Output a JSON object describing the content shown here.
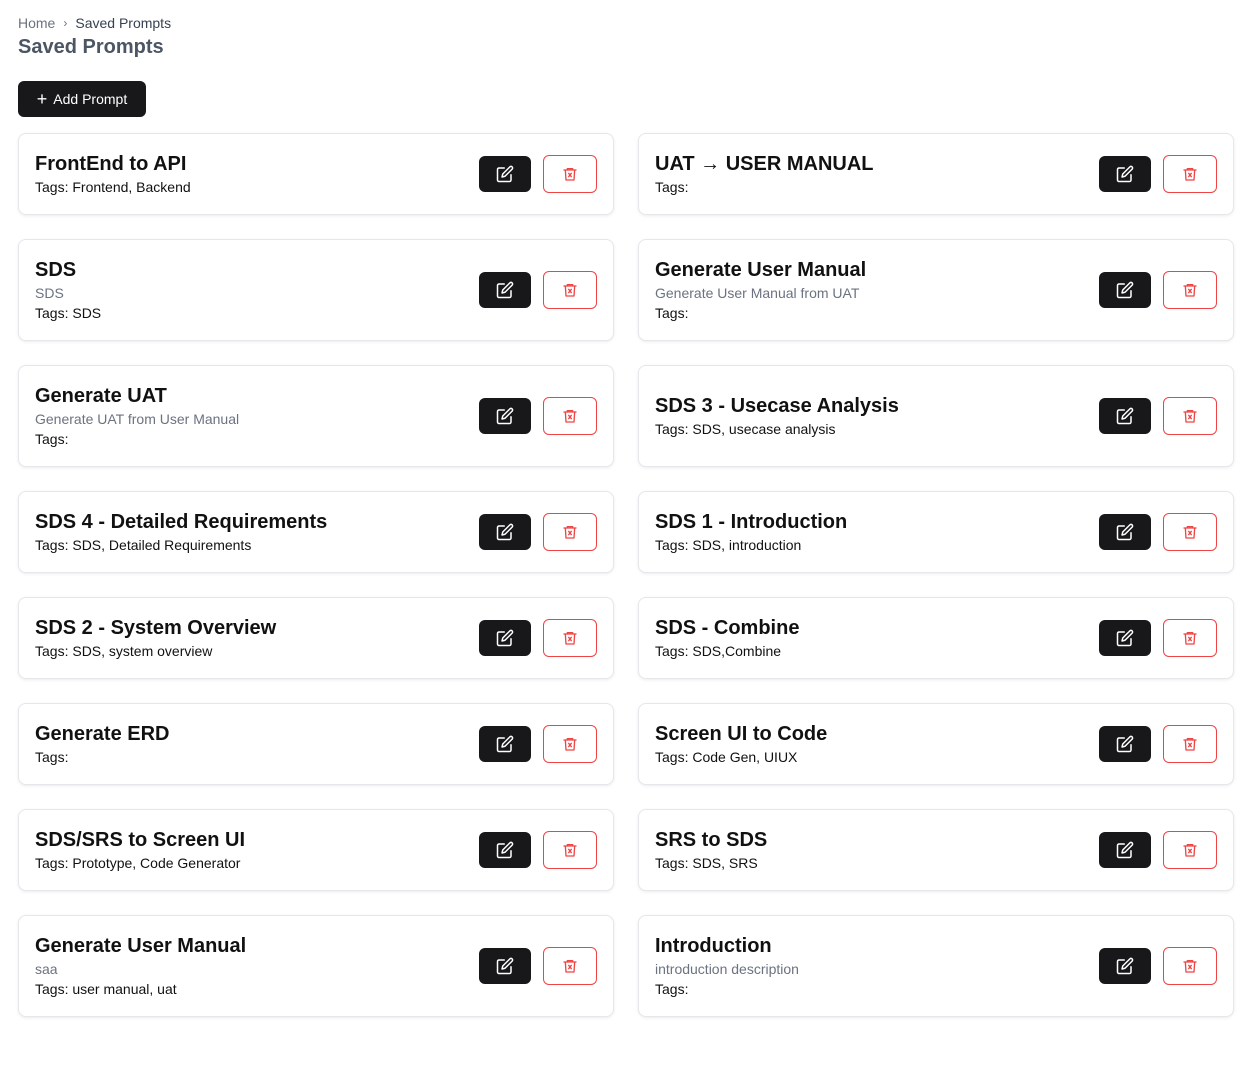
{
  "breadcrumb": {
    "home": "Home",
    "separator": "›",
    "current": "Saved Prompts"
  },
  "page_title": "Saved Prompts",
  "add_button": {
    "icon": "plus-icon",
    "label": "Add Prompt"
  },
  "colors": {
    "primary": "#18181b",
    "danger": "#ef4444",
    "muted": "#6b7280"
  },
  "prompts_left": [
    {
      "title": "FrontEnd to API",
      "description": "",
      "tags": "Tags: Frontend, Backend"
    },
    {
      "title": "SDS",
      "description": "SDS",
      "tags": "Tags: SDS"
    },
    {
      "title": "Generate UAT",
      "description": "Generate UAT from User Manual",
      "tags": "Tags:"
    },
    {
      "title": "SDS 4 - Detailed Requirements",
      "description": "",
      "tags": "Tags: SDS, Detailed Requirements"
    },
    {
      "title": "SDS 2 - System Overview",
      "description": "",
      "tags": "Tags: SDS, system overview"
    },
    {
      "title": "Generate ERD",
      "description": "",
      "tags": "Tags:"
    },
    {
      "title": "SDS/SRS to Screen UI",
      "description": "",
      "tags": "Tags: Prototype, Code Generator"
    },
    {
      "title": "Generate User Manual",
      "description": "saa",
      "tags": "Tags: user manual, uat"
    }
  ],
  "prompts_right": [
    {
      "title": "UAT → USER MANUAL",
      "description": "",
      "tags": "Tags:"
    },
    {
      "title": "Generate User Manual",
      "description": "Generate User Manual from UAT",
      "tags": "Tags:"
    },
    {
      "title": "SDS 3 - Usecase Analysis",
      "description": "",
      "tags": "Tags: SDS, usecase analysis"
    },
    {
      "title": "SDS 1 - Introduction",
      "description": "",
      "tags": "Tags: SDS, introduction"
    },
    {
      "title": "SDS - Combine",
      "description": "",
      "tags": "Tags: SDS,Combine"
    },
    {
      "title": "Screen UI to Code",
      "description": "",
      "tags": "Tags: Code Gen, UIUX"
    },
    {
      "title": "SRS to SDS",
      "description": "",
      "tags": "Tags: SDS, SRS"
    },
    {
      "title": "Introduction",
      "description": "introduction description",
      "tags": "Tags:"
    }
  ]
}
